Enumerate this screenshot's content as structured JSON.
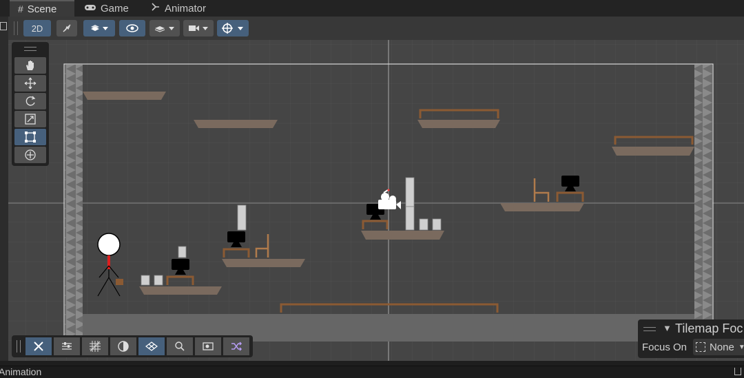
{
  "tabs": [
    {
      "label": "Scene",
      "icon": "hash-icon",
      "active": true
    },
    {
      "label": "Game",
      "icon": "gamepad-icon",
      "active": false
    },
    {
      "label": "Animator",
      "icon": "animator-icon",
      "active": false
    }
  ],
  "toolbar": {
    "mode_2d_label": "2D",
    "buttons": [
      "2d-toggle",
      "lighting-toggle",
      "gizmos-layers-dropdown",
      "visibility-toggle",
      "layers-dropdown",
      "camera-dropdown",
      "gizmos-dropdown"
    ]
  },
  "tools": [
    "hand-icon",
    "move-icon",
    "rotate-icon",
    "scale-icon",
    "rect-icon",
    "transform-icon"
  ],
  "active_tool": "rect-icon",
  "overlay_tools": [
    "tools-icon",
    "properties-icon",
    "grid-snap-icon",
    "shading-icon",
    "grid-icon",
    "search-icon",
    "camera-preview-icon",
    "shuffle-icon"
  ],
  "tilemap_overlay": {
    "title": "Tilemap Foc",
    "focus_label": "Focus On",
    "focus_value": "None"
  },
  "status": {
    "left": "Animation"
  },
  "colors": {
    "accent": "#46607c",
    "viewport": "#444444",
    "platform": "#7a6a5e",
    "wood": "#8b5a33"
  }
}
